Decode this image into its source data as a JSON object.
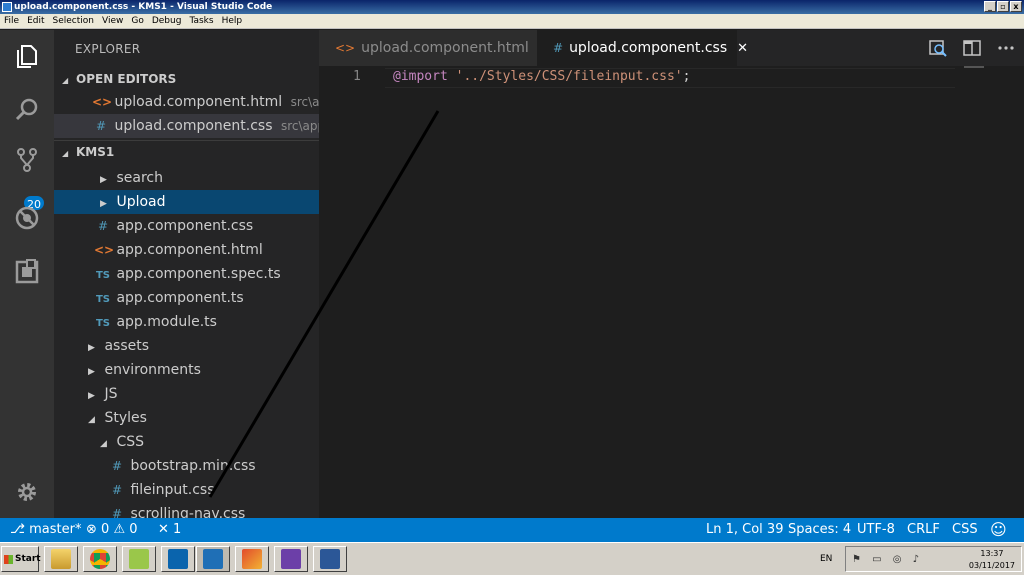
{
  "window": {
    "title": "upload.component.css - KMS1 - Visual Studio Code",
    "buttons": [
      "_",
      "▫",
      "x"
    ]
  },
  "menu": [
    "File",
    "Edit",
    "Selection",
    "View",
    "Go",
    "Debug",
    "Tasks",
    "Help"
  ],
  "activity": {
    "icons": [
      "files-icon",
      "search-icon",
      "source-control-icon",
      "debug-icon",
      "extensions-icon",
      "gear-icon"
    ],
    "scm_badge": "20"
  },
  "sidebar": {
    "title": "EXPLORER",
    "open_editors_header": "OPEN EDITORS",
    "open_editors": [
      {
        "name": "upload.component.html",
        "path": "src\\app...",
        "icon": "<>"
      },
      {
        "name": "upload.component.css",
        "path": "src\\app\\...",
        "icon": "#"
      }
    ],
    "project_header": "KMS1",
    "tree": [
      {
        "label": "search",
        "kind": "folder"
      },
      {
        "label": "Upload",
        "kind": "folder"
      },
      {
        "label": "app.component.css",
        "kind": "css"
      },
      {
        "label": "app.component.html",
        "kind": "html"
      },
      {
        "label": "app.component.spec.ts",
        "kind": "ts"
      },
      {
        "label": "app.component.ts",
        "kind": "ts"
      },
      {
        "label": "app.module.ts",
        "kind": "ts"
      },
      {
        "label": "assets",
        "kind": "folder"
      },
      {
        "label": "environments",
        "kind": "folder"
      },
      {
        "label": "JS",
        "kind": "folder"
      },
      {
        "label": "Styles",
        "kind": "folder-open"
      },
      {
        "label": "CSS",
        "kind": "folder-open"
      },
      {
        "label": "bootstrap.min.css",
        "kind": "css"
      },
      {
        "label": "fileinput.css",
        "kind": "css"
      },
      {
        "label": "scrolling-nav.css",
        "kind": "css"
      }
    ]
  },
  "tabs": [
    {
      "label": "upload.component.html",
      "icon": "<>"
    },
    {
      "label": "upload.component.css",
      "icon": "#",
      "close": "✕"
    }
  ],
  "editor": {
    "line_number": "1",
    "keyword": "@import",
    "string": "'../Styles/CSS/fileinput.css'",
    "punct": ";"
  },
  "status": {
    "branch": "master*",
    "errors": "0",
    "warnings": "0",
    "tools": "1",
    "position": "Ln 1, Col 39",
    "spaces": "Spaces: 4",
    "encoding": "UTF-8",
    "eol": "CRLF",
    "language": "CSS"
  },
  "taskbar": {
    "start": "Start",
    "lang": "EN",
    "time": "13:37",
    "date": "03/11/2017"
  },
  "colors": {
    "accent": "#007acc",
    "selection": "#094771",
    "sidebar": "#252526",
    "editor": "#1e1e1e"
  }
}
